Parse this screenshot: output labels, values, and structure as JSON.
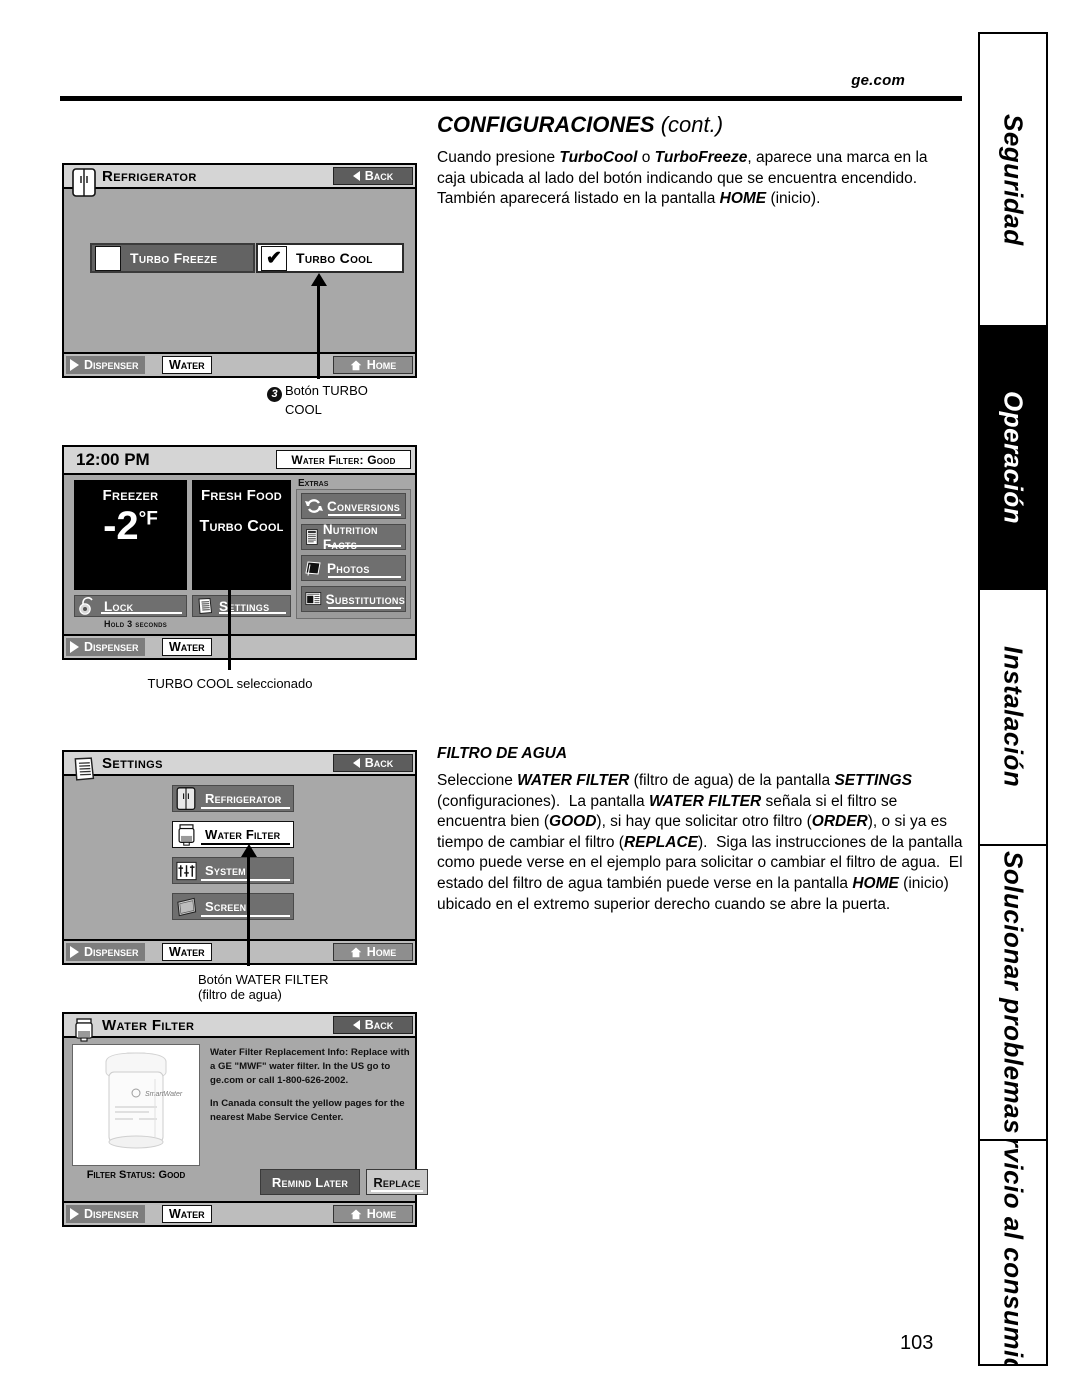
{
  "header": {
    "site": "ge.com"
  },
  "page": {
    "number": "103"
  },
  "sidebar": {
    "tabs": [
      {
        "label": "Seguridad",
        "active": false
      },
      {
        "label": "Operación",
        "active": true
      },
      {
        "label": "Instalación",
        "active": false
      },
      {
        "label": "Solucionar problemas",
        "active": false
      },
      {
        "label": "Servicio al consumidor",
        "active": false
      }
    ]
  },
  "main": {
    "section_title_bold": "CONFIGURACIONES",
    "section_title_cont": "(cont.)",
    "intro_html": "Cuando presione <b>TurboCool</b> o <b>TurboFreeze</b>, aparece una marca en la caja ubicada al lado del botón indicando que se encuentra encendido. También aparecerá listado en la pantalla <b>HOME</b> (inicio).",
    "water_filter_title": "FILTRO DE AGUA",
    "water_filter_html": "Seleccione <b>WATER FILTER</b> (filtro de agua) de la pantalla <b>SETTINGS</b> (configuraciones).&nbsp; La pantalla <b>WATER FILTER</b> señala si el filtro se encuentra bien (<b>GOOD</b>), si hay que solicitar otro filtro (<b>ORDER</b>), o si ya es tiempo de cambiar el filtro (<b>REPLACE</b>).&nbsp; Siga las instrucciones de la pantalla como puede verse en el ejemplo para solicitar o cambiar el filtro de agua.&nbsp; El estado del filtro de agua también puede verse en la pantalla <b>HOME</b> (inicio) ubicado en el extremo superior derecho cuando se abre la puerta."
  },
  "screen_refrigerator": {
    "title": "Refrigerator",
    "back_label": "Back",
    "home_label": "Home",
    "dispenser_label": "Dispenser",
    "water_label": "Water",
    "options": [
      {
        "label": "Turbo Freeze",
        "checked": false
      },
      {
        "label": "Turbo Cool",
        "checked": true
      }
    ]
  },
  "callout_turbo": {
    "number": "3",
    "line1": "Botón TURBO",
    "line2": "COOL"
  },
  "screen_home": {
    "clock": "12:00 PM",
    "water_filter_chip": "Water Filter: Good",
    "freezer": {
      "caption": "Freezer",
      "value": "-2",
      "unit": "°F"
    },
    "fresh_food": {
      "caption": "Fresh Food",
      "mode": "Turbo Cool"
    },
    "lock_label": "Lock",
    "lock_hint": "Hold 3 seconds",
    "settings_label": "Settings",
    "extras_label": "Extras",
    "extras": [
      {
        "label": "Conversions",
        "icon": "conversions-icon"
      },
      {
        "label": "Nutrition Facts",
        "icon": "nutrition-icon"
      },
      {
        "label": "Photos",
        "icon": "photos-icon"
      },
      {
        "label": "Substitutions",
        "icon": "substitutions-icon"
      }
    ],
    "dispenser_label": "Dispenser",
    "water_label": "Water"
  },
  "callout_home": {
    "text": "TURBO COOL seleccionado"
  },
  "screen_settings": {
    "title": "Settings",
    "back_label": "Back",
    "home_label": "Home",
    "dispenser_label": "Dispenser",
    "water_label": "Water",
    "items": [
      {
        "label": "Refrigerator",
        "selected": false
      },
      {
        "label": "Water Filter",
        "selected": true
      },
      {
        "label": "System",
        "selected": false
      },
      {
        "label": "Screen",
        "selected": false
      }
    ]
  },
  "callout_settings": {
    "line1": "Botón WATER FILTER",
    "line2": "(filtro de agua)"
  },
  "screen_water_filter": {
    "title": "Water Filter",
    "back_label": "Back",
    "home_label": "Home",
    "dispenser_label": "Dispenser",
    "water_label": "Water",
    "filter_status": "Filter Status: Good",
    "info_p1": "Water Filter Replacement Info: Replace with a GE \"MWF\" water filter. In the US go to ge.com or call 1-800-626-2002.",
    "info_p2": "In Canada consult the yellow pages for the nearest Mabe Service Center.",
    "remind_label": "Remind Later",
    "replace_label": "Replace",
    "cartridge_brand": "SmartWater"
  }
}
